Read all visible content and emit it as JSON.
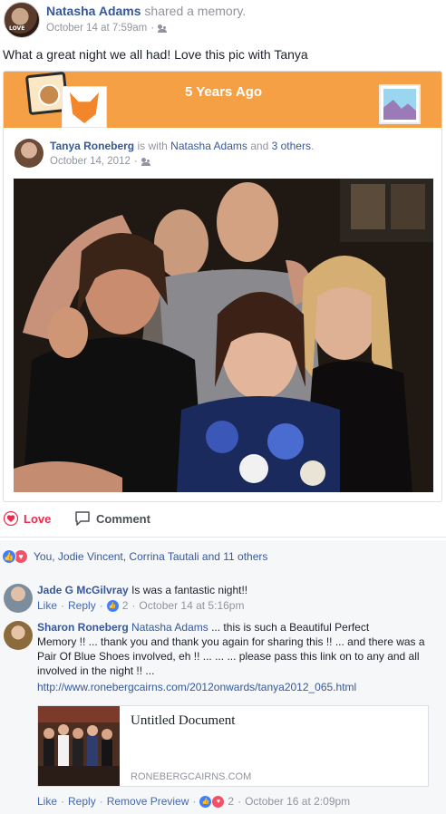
{
  "post": {
    "author": "Natasha Adams",
    "action_text": "shared a memory.",
    "timestamp": "October 14 at 7:59am",
    "separator": "·",
    "avatar_text": "LOVE",
    "status": "What a great night we all had! Love this pic with Tanya"
  },
  "memory": {
    "banner_title": "5 Years Ago",
    "author": "Tanya Roneberg",
    "with_text": "is with",
    "tagged": "Natasha Adams",
    "and_text": "and",
    "others": "3 others",
    "period": ".",
    "timestamp": "October 14, 2012",
    "separator": "·"
  },
  "actions": {
    "love_label": "Love",
    "comment_label": "Comment"
  },
  "reactions": {
    "summary": "You, Jodie Vincent, Corrina Tautali and 11 others"
  },
  "comments": [
    {
      "author": "Jade G McGilvray",
      "text": "Is was a fantastic night!!",
      "like_label": "Like",
      "reply_label": "Reply",
      "reaction_count": "2",
      "timestamp": "October 14 at 5:16pm",
      "separator": "·"
    },
    {
      "author": "Sharon Roneberg",
      "mention": "Natasha Adams",
      "text_line1": "... this is such a Beautiful Perfect",
      "text_line2": "Memory !! ... thank you and thank you again for sharing this !! ... and there was a",
      "text_line3": "Pair Of Blue Shoes involved, eh !! ... ... ... please pass this link on to any and all",
      "text_line4": "involved in the night !! ...",
      "url": "http://www.ronebergcairns.com/2012onwards/tanya2012_065.html",
      "preview_title": "Untitled Document",
      "preview_domain": "RONEBERGCAIRNS.COM",
      "like_label": "Like",
      "reply_label": "Reply",
      "remove_label": "Remove Preview",
      "reaction_count": "2",
      "timestamp": "October 16 at 2:09pm",
      "separator": "·"
    }
  ],
  "colors": {
    "link": "#365899",
    "banner": "#f5a045",
    "love": "#f0284a",
    "meta": "#90949c"
  }
}
